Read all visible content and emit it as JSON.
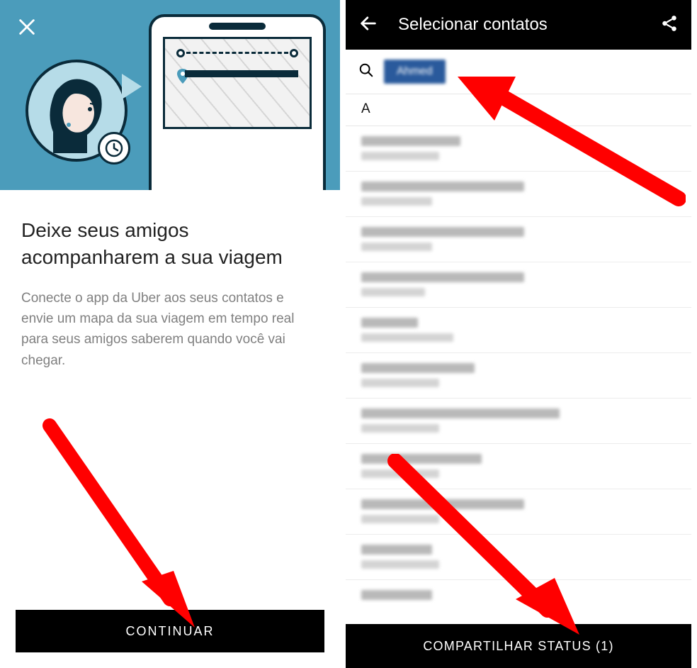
{
  "screen1": {
    "title": "Deixe seus amigos acompanharem a sua viagem",
    "description": "Conecte o app da Uber aos seus contatos e envie um mapa da sua viagem em tempo real para seus amigos saberem quando você vai chegar.",
    "continue_button": "CONTINUAR"
  },
  "screen2": {
    "header_title": "Selecionar contatos",
    "search_chip": "Ahmed",
    "section_header": "A",
    "contacts": [
      {
        "w1": 140,
        "w2": 110
      },
      {
        "w1": 230,
        "w2": 100
      },
      {
        "w1": 230,
        "w2": 100
      },
      {
        "w1": 230,
        "w2": 90
      },
      {
        "w1": 80,
        "w2": 130
      },
      {
        "w1": 160,
        "w2": 110
      },
      {
        "w1": 280,
        "w2": 110
      },
      {
        "w1": 170,
        "w2": 110
      },
      {
        "w1": 230,
        "w2": 110
      },
      {
        "w1": 100,
        "w2": 110
      },
      {
        "w1": 100,
        "w2": 0
      }
    ],
    "share_button": "COMPARTILHAR STATUS (1)"
  },
  "colors": {
    "hero_bg": "#4b9cbb",
    "accent_dark": "#0a2b3a",
    "chip_bg": "#2a5a9c",
    "arrow_red": "#ff0000"
  }
}
